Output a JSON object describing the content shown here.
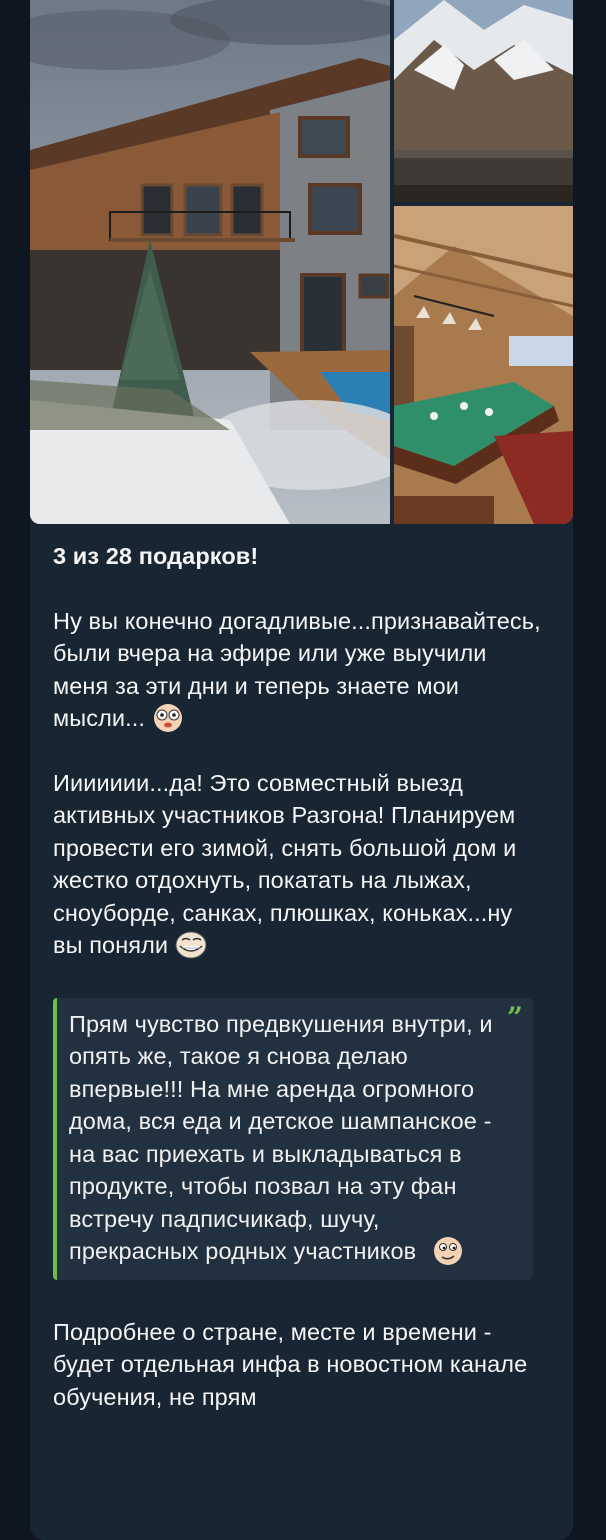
{
  "post": {
    "photos": [
      {
        "name": "house-photo"
      },
      {
        "name": "mountains-photo"
      },
      {
        "name": "billiard-room-photo"
      }
    ],
    "title": "3 из 28 подарков!",
    "paragraph1": "Ну вы конечно догадливые...признавайтесь, были вчера на эфире или уже выучили меня за эти дни и теперь знаете мои мысли...",
    "paragraph1_emoji": "flushed-face-icon",
    "paragraph2": "Иииииии...да! Это совместный выезд активных участников Разгона! Планируем провести его зимой, снять большой дом и жестко отдохнуть, покатать на лыжах, сноуборде, санках, плюшках, коньках...ну вы поняли",
    "paragraph2_emoji": "troll-face-icon",
    "quote": {
      "text": "Прям чувство предвкушения внутри, и опять же, такое я снова делаю впервые!!! На мне аренда огромного дома, вся еда и детское шампанское - на вас приехать и выкладываться в продукте, чтобы позвал на эту фан встречу падписчикаф, шучу, прекрасных родных участников",
      "emoji": "smirk-face-icon",
      "mark": "”"
    },
    "paragraph3": "Подробнее о стране, месте и времени - будет отдельная инфа в новостном канале обучения, не прям"
  },
  "colors": {
    "background": "#0e1621",
    "bubble": "#182533",
    "quote_background": "#213140",
    "quote_accent": "#6fbe4b",
    "text": "#f5f5f5"
  }
}
